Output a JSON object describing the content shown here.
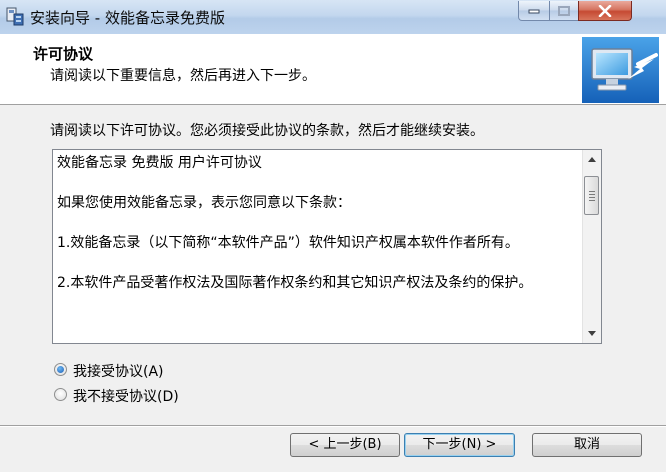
{
  "window": {
    "title": "安装向导 - 效能备忘录免费版"
  },
  "header": {
    "title": "许可协议",
    "subtitle": "请阅读以下重要信息，然后再进入下一步。"
  },
  "body": {
    "intro": "请阅读以下许可协议。您必须接受此协议的条款，然后才能继续安装。",
    "license_paragraphs": [
      "效能备忘录 免费版 用户许可协议",
      "如果您使用效能备忘录，表示您同意以下条款：",
      "1.效能备忘录（以下简称“本软件产品”）软件知识产权属本软件作者所有。",
      "2.本软件产品受著作权法及国际著作权条约和其它知识产权法及条约的保护。"
    ],
    "options": [
      {
        "label": "我接受协议(A)",
        "selected": true
      },
      {
        "label": "我不接受协议(D)",
        "selected": false
      }
    ]
  },
  "buttons": {
    "back": "< 上一步(B)",
    "next": "下一步(N) >",
    "cancel": "取消"
  },
  "icons": {
    "title_icon": "installer-icon",
    "header_graphic": "computer-install-icon"
  }
}
